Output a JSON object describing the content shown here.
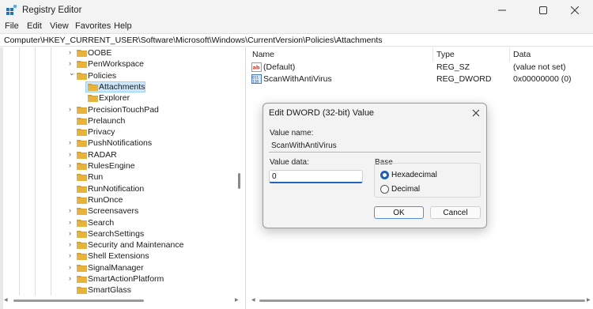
{
  "window": {
    "title": "Registry Editor"
  },
  "menu": [
    "File",
    "Edit",
    "View",
    "Favorites",
    "Help"
  ],
  "address": "Computer\\HKEY_CURRENT_USER\\Software\\Microsoft\\Windows\\CurrentVersion\\Policies\\Attachments",
  "tree": [
    {
      "label": "OOBE",
      "expander": "collapsed"
    },
    {
      "label": "PenWorkspace",
      "expander": "collapsed"
    },
    {
      "label": "Policies",
      "expander": "expanded"
    },
    {
      "label": "Attachments",
      "expander": "none",
      "selected": true
    },
    {
      "label": "Explorer",
      "expander": "none"
    },
    {
      "label": "PrecisionTouchPad",
      "expander": "collapsed"
    },
    {
      "label": "Prelaunch",
      "expander": "none"
    },
    {
      "label": "Privacy",
      "expander": "none"
    },
    {
      "label": "PushNotifications",
      "expander": "collapsed"
    },
    {
      "label": "RADAR",
      "expander": "collapsed"
    },
    {
      "label": "RulesEngine",
      "expander": "collapsed"
    },
    {
      "label": "Run",
      "expander": "none"
    },
    {
      "label": "RunNotification",
      "expander": "none"
    },
    {
      "label": "RunOnce",
      "expander": "none"
    },
    {
      "label": "Screensavers",
      "expander": "collapsed"
    },
    {
      "label": "Search",
      "expander": "collapsed"
    },
    {
      "label": "SearchSettings",
      "expander": "collapsed"
    },
    {
      "label": "Security and Maintenance",
      "expander": "collapsed"
    },
    {
      "label": "Shell Extensions",
      "expander": "collapsed"
    },
    {
      "label": "SignalManager",
      "expander": "collapsed"
    },
    {
      "label": "SmartActionPlatform",
      "expander": "collapsed"
    },
    {
      "label": "SmartGlass",
      "expander": "none"
    }
  ],
  "list": {
    "columns": [
      "Name",
      "Type",
      "Data"
    ],
    "rows": [
      {
        "name": "(Default)",
        "type": "REG_SZ",
        "data": "(value not set)",
        "icon": "string-value-icon"
      },
      {
        "name": "ScanWithAntiVirus",
        "type": "REG_DWORD",
        "data": "0x00000000 (0)",
        "icon": "dword-value-icon"
      }
    ]
  },
  "dialog": {
    "title": "Edit DWORD (32-bit) Value",
    "value_name_label": "Value name:",
    "value_name": "ScanWithAntiVirus",
    "value_data_label": "Value data:",
    "value_data": "0",
    "base_label": "Base",
    "base_options": [
      "Hexadecimal",
      "Decimal"
    ],
    "base_selected": "Hexadecimal",
    "ok_label": "OK",
    "cancel_label": "Cancel"
  },
  "colors": {
    "selection": "#cce8ff",
    "accent": "#1f63bd",
    "folder": "#e8b339"
  }
}
